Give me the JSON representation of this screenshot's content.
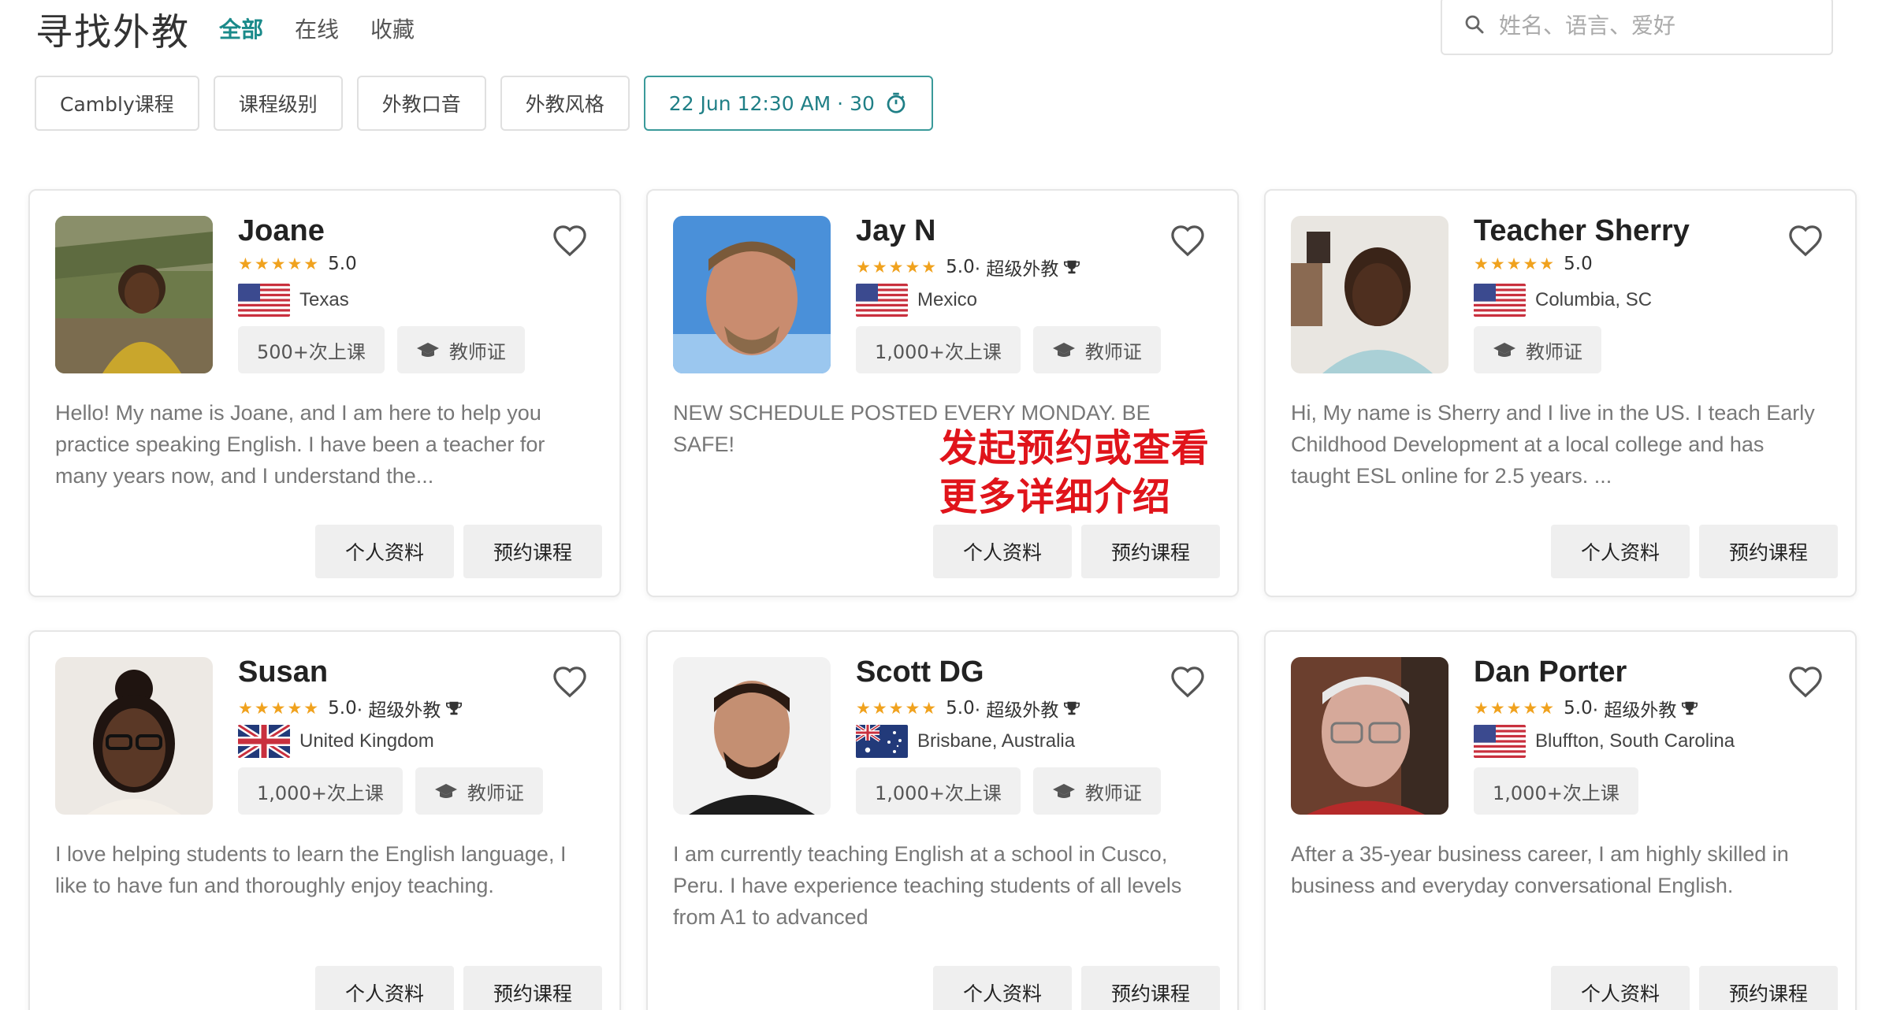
{
  "header": {
    "title": "寻找外教",
    "tabs": [
      {
        "label": "全部",
        "active": true
      },
      {
        "label": "在线",
        "active": false
      },
      {
        "label": "收藏",
        "active": false
      }
    ],
    "search_placeholder": "姓名、语言、爱好"
  },
  "filters": [
    {
      "label": "Cambly课程"
    },
    {
      "label": "课程级别"
    },
    {
      "label": "外教口音"
    },
    {
      "label": "外教风格"
    },
    {
      "label": "22 Jun 12:30 AM · 30"
    }
  ],
  "annotation": {
    "line1": "发起预约或查看",
    "line2": "更多详细介绍"
  },
  "buttons": {
    "profile": "个人资料",
    "book": "预约课程"
  },
  "tutors": [
    {
      "name": "Joane",
      "stars": "★★★★★",
      "rating": "5.0",
      "super": "",
      "location": "Texas",
      "flag": "us",
      "badges": [
        "500+次上课",
        "教师证"
      ],
      "bio": "Hello! My name is Joane, and I am here to help you practice speaking English. I have been a teacher for many years now, and I understand the..."
    },
    {
      "name": "Jay N",
      "stars": "★★★★★",
      "rating": "5.0",
      "super": " · 超级外教",
      "location": "Mexico",
      "flag": "us",
      "badges": [
        "1,000+次上课",
        "教师证"
      ],
      "bio": "NEW SCHEDULE POSTED EVERY MONDAY. BE SAFE!"
    },
    {
      "name": "Teacher Sherry",
      "stars": "★★★★★",
      "rating": "5.0",
      "super": "",
      "location": "Columbia, SC",
      "flag": "us",
      "badges": [
        "教师证"
      ],
      "bio": "Hi, My name is Sherry and I live in the US. I teach Early Childhood Development at a local college and has taught ESL online for 2.5 years. ..."
    },
    {
      "name": "Susan",
      "stars": "★★★★★",
      "rating": "5.0",
      "super": " · 超级外教",
      "location": "United Kingdom",
      "flag": "uk",
      "badges": [
        "1,000+次上课",
        "教师证"
      ],
      "bio": "I love helping students to learn the English language, I like to have fun and thoroughly enjoy teaching."
    },
    {
      "name": "Scott DG",
      "stars": "★★★★★",
      "rating": "5.0",
      "super": " · 超级外教",
      "location": "Brisbane, Australia",
      "flag": "au",
      "badges": [
        "1,000+次上课",
        "教师证"
      ],
      "bio": "I am currently teaching English at a school in Cusco, Peru. I have experience teaching students of all levels from A1 to advanced"
    },
    {
      "name": "Dan Porter",
      "stars": "★★★★★",
      "rating": "5.0",
      "super": " · 超级外教",
      "location": "Bluffton, South Carolina",
      "flag": "us",
      "badges": [
        "1,000+次上课"
      ],
      "bio": "After a 35-year business career, I am highly skilled in business and everyday conversational English."
    }
  ]
}
